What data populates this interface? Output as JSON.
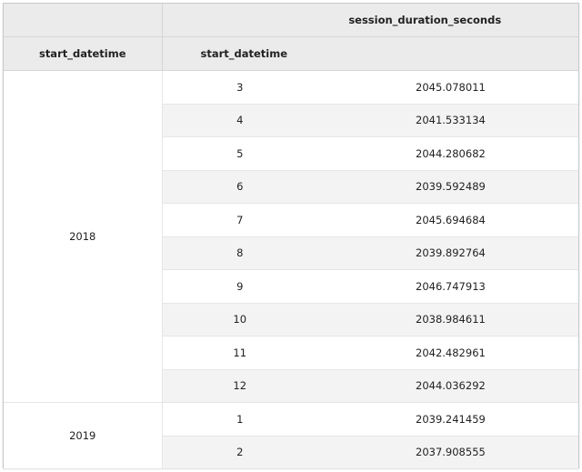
{
  "table": {
    "header_top_value": "session_duration_seconds",
    "header_index_level0": "start_datetime",
    "header_index_level1": "start_datetime",
    "groups": [
      {
        "label": "2018",
        "rows": [
          {
            "sub": "3",
            "value": "2045.078011"
          },
          {
            "sub": "4",
            "value": "2041.533134"
          },
          {
            "sub": "5",
            "value": "2044.280682"
          },
          {
            "sub": "6",
            "value": "2039.592489"
          },
          {
            "sub": "7",
            "value": "2045.694684"
          },
          {
            "sub": "8",
            "value": "2039.892764"
          },
          {
            "sub": "9",
            "value": "2046.747913"
          },
          {
            "sub": "10",
            "value": "2038.984611"
          },
          {
            "sub": "11",
            "value": "2042.482961"
          },
          {
            "sub": "12",
            "value": "2044.036292"
          }
        ]
      },
      {
        "label": "2019",
        "rows": [
          {
            "sub": "1",
            "value": "2039.241459"
          },
          {
            "sub": "2",
            "value": "2037.908555"
          }
        ]
      }
    ]
  }
}
